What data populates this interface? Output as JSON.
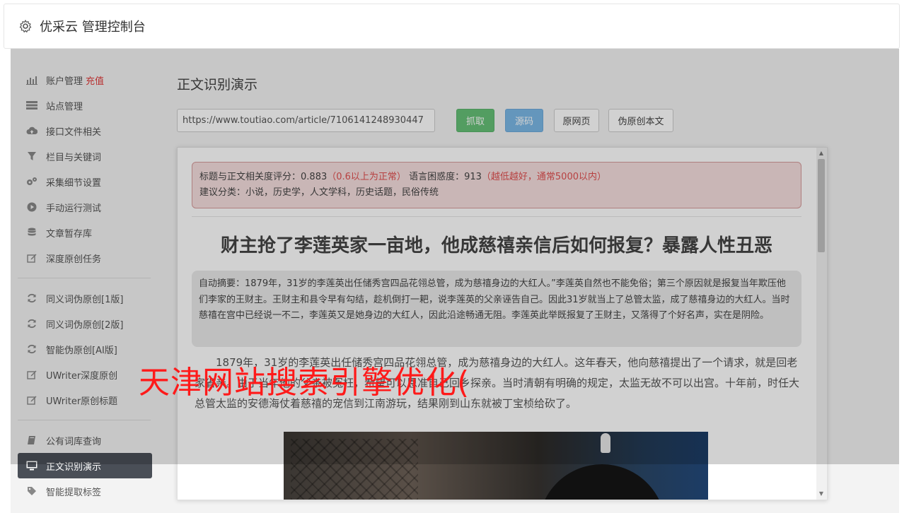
{
  "header": {
    "title": "优采云 管理控制台"
  },
  "sidebar": {
    "group1": [
      {
        "label": "账户管理",
        "badge": "充值",
        "icon": "chart-icon"
      },
      {
        "label": "站点管理",
        "icon": "server-icon"
      },
      {
        "label": "接口文件相关",
        "icon": "cloud-upload-icon"
      },
      {
        "label": "栏目与关键词",
        "icon": "filter-icon"
      },
      {
        "label": "采集细节设置",
        "icon": "gears-icon"
      },
      {
        "label": "手动运行测试",
        "icon": "play-circle-icon"
      },
      {
        "label": "文章暂存库",
        "icon": "database-icon"
      },
      {
        "label": "深度原创任务",
        "icon": "edit-icon"
      }
    ],
    "group2": [
      {
        "label": "同义词伪原创[1版]",
        "icon": "refresh-icon"
      },
      {
        "label": "同义词伪原创[2版]",
        "icon": "refresh-icon"
      },
      {
        "label": "智能伪原创[AI版]",
        "icon": "refresh-icon"
      },
      {
        "label": "UWriter深度原创",
        "icon": "edit-icon"
      },
      {
        "label": "UWriter原创标题",
        "icon": "edit-icon"
      }
    ],
    "group3": [
      {
        "label": "公有词库查询",
        "icon": "book-icon"
      },
      {
        "label": "正文识别演示",
        "icon": "monitor-icon",
        "active": true
      },
      {
        "label": "智能提取标签",
        "icon": "tag-icon"
      }
    ]
  },
  "main": {
    "title": "正文识别演示",
    "url_value": "https://www.toutiao.com/article/7106141248930447",
    "buttons": {
      "fetch": "抓取",
      "source": "源码",
      "original": "原网页",
      "rewrite": "伪原创本文"
    }
  },
  "result": {
    "relevance_label": "标题与正文相关度评分：",
    "relevance_value": "0.883",
    "relevance_note": "（0.6以上为正常）",
    "perplexity_label": "语言困惑度：",
    "perplexity_value": "913",
    "perplexity_note": "（越低越好，通常5000以内）",
    "category_line": "建议分类：小说，历史学，人文学科，历史话题，民俗传统",
    "article_title": "财主抢了李莲英家一亩地，他成慈禧亲信后如何报复？暴露人性丑恶",
    "summary": "自动摘要：1879年，31岁的李莲英出任储秀宫四品花翎总管，成为慈禧身边的大红人。”李莲英自然也不能免俗；第三个原因就是报复当年欺压他们李家的王财主。王财主和县令早有勾结，趁机倒打一耙，说李莲英的父亲诬告自己。因此31岁就当上了总管太监，成了慈禧身边的大红人。当时慈禧在宫中已经说一不二，李莲英又是她身边的大红人，因此沿途畅通无阻。李莲英此举既报复了王财主，又落得了个好名声，实在是阴险。",
    "body": "1879年，31岁的李莲英出任储秀宫四品花翎总管，成为慈禧身边的大红人。这年春天，他向慈禧提出了一个请求，就是回老家省亲。由于当年他的父亲被冤枉，希望可以恩准自己回乡探亲。当时清朝有明确的规定，太监无故不可以出宫。十年前，时任大总管太监的安德海仗着慈禧的宠信到江南游玩，结果刚到山东就被丁宝桢给砍了。"
  },
  "watermark": "天津网站搜索引擎优化("
}
